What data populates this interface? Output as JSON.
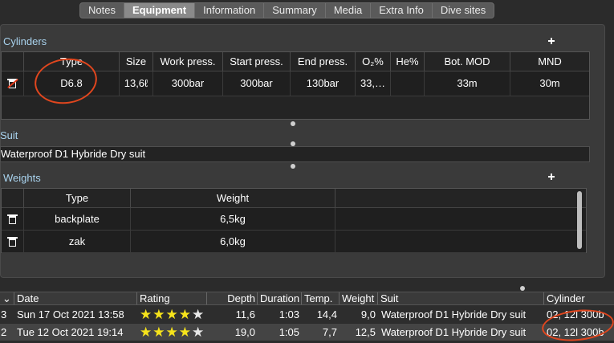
{
  "tabs": [
    {
      "label": "Notes",
      "active": false
    },
    {
      "label": "Equipment",
      "active": true
    },
    {
      "label": "Information",
      "active": false
    },
    {
      "label": "Summary",
      "active": false
    },
    {
      "label": "Media",
      "active": false
    },
    {
      "label": "Extra Info",
      "active": false
    },
    {
      "label": "Dive sites",
      "active": false
    }
  ],
  "cylinders": {
    "title": "Cylinders",
    "columns": [
      "",
      "Type",
      "Size",
      "Work press.",
      "Start press.",
      "End press.",
      "O₂%",
      "He%",
      "Bot. MOD",
      "MND"
    ],
    "rows": [
      {
        "type": "D6.8",
        "size": "13,6ℓ",
        "work": "300bar",
        "start": "300bar",
        "end": "130bar",
        "o2": "33,…",
        "he": "",
        "mod": "33m",
        "mnd": "30m"
      }
    ]
  },
  "suit": {
    "title": "Suit",
    "value": "Waterproof D1 Hybride Dry suit"
  },
  "weights": {
    "title": "Weights",
    "columns": [
      "",
      "Type",
      "Weight"
    ],
    "rows": [
      {
        "type": "backplate",
        "weight": "6,5kg"
      },
      {
        "type": "zak",
        "weight": "6,0kg"
      }
    ]
  },
  "dive_list": {
    "columns": [
      "",
      "Date",
      "Rating",
      "Depth",
      "Duration",
      "Temp.",
      "Weight",
      "Suit",
      "Cylinder"
    ],
    "rows": [
      {
        "num": "3",
        "date": "Sun 17 Oct 2021 13:58",
        "rating": 4,
        "depth": "11,6",
        "duration": "1:03",
        "temp": "14,4",
        "weight": "9,0",
        "suit": "Waterproof D1 Hybride Dry suit",
        "cylinder": "02, 12l 300b"
      },
      {
        "num": "2",
        "date": "Tue 12 Oct 2021 19:14",
        "rating": 4,
        "depth": "19,0",
        "duration": "1:05",
        "temp": "7,7",
        "weight": "12,5",
        "suit": "Waterproof D1 Hybride Dry suit",
        "cylinder": "02, 12l 300b"
      }
    ]
  },
  "colors": {
    "section_title": "#a9d3ee",
    "star": "#f6e31b",
    "annotation": "#e0461e"
  }
}
